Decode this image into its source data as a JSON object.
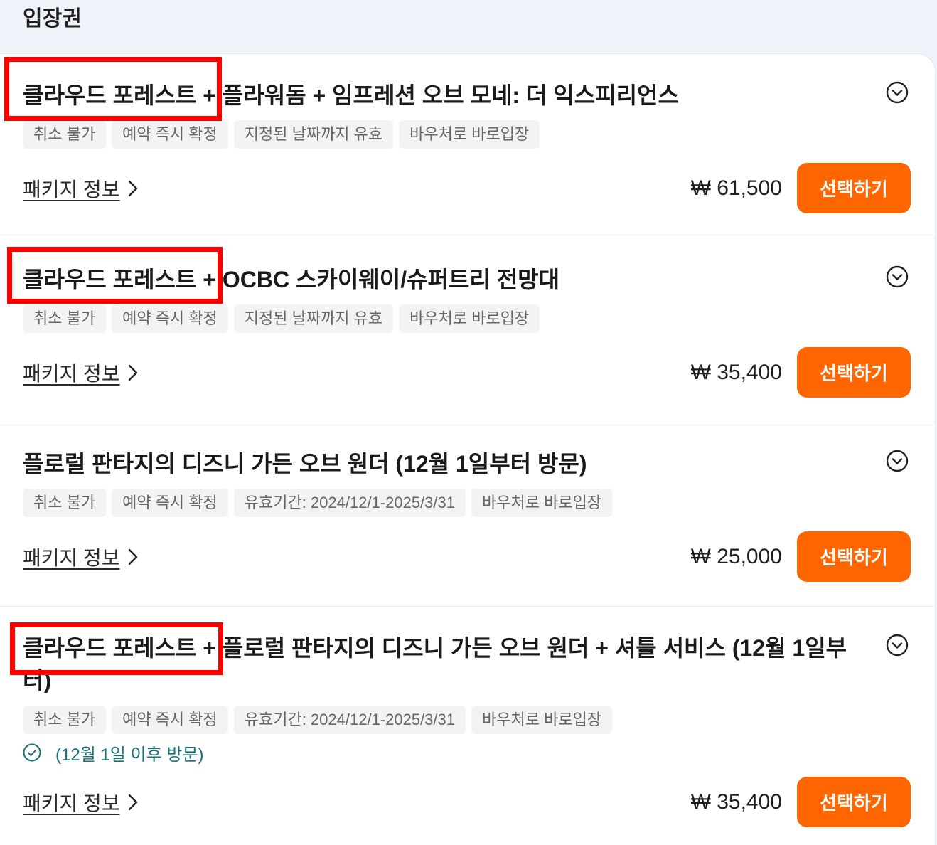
{
  "section": {
    "title": "입장권"
  },
  "packages": [
    {
      "title": "클라우드 포레스트 + 플라워돔 + 임프레션 오브 모네: 더 익스피리언스",
      "tags": [
        "취소 불가",
        "예약 즉시 확정",
        "지정된 날짜까지 유효",
        "바우처로 바로입장"
      ],
      "info_label": "패키지 정보",
      "price": "₩ 61,500",
      "select_label": "선택하기"
    },
    {
      "title": "클라우드 포레스트 + OCBC 스카이웨이/슈퍼트리 전망대",
      "tags": [
        "취소 불가",
        "예약 즉시 확정",
        "지정된 날짜까지 유효",
        "바우처로 바로입장"
      ],
      "info_label": "패키지 정보",
      "price": "₩ 35,400",
      "select_label": "선택하기"
    },
    {
      "title": "플로럴 판타지의 디즈니 가든 오브 원더 (12월 1일부터 방문)",
      "tags": [
        "취소 불가",
        "예약 즉시 확정",
        "유효기간: 2024/12/1-2025/3/31",
        "바우처로 바로입장"
      ],
      "info_label": "패키지 정보",
      "price": "₩ 25,000",
      "select_label": "선택하기"
    },
    {
      "title": "클라우드 포레스트 + 플로럴 판타지의 디즈니 가든 오브 원더 + 셔틀 서비스 (12월 1일부터)",
      "tags": [
        "취소 불가",
        "예약 즉시 확정",
        "유효기간: 2024/12/1-2025/3/31",
        "바우처로 바로입장"
      ],
      "note": "(12월 1일 이후 방문)",
      "info_label": "패키지 정보",
      "price": "₩ 35,400",
      "select_label": "선택하기"
    }
  ],
  "icons": {
    "expand": "chevron-down-circle-icon",
    "info_arrow": "chevron-right-icon",
    "note": "check-circle-icon"
  },
  "colors": {
    "accent": "#ff6600",
    "note": "#17707a",
    "tag_background": "#f2f3f5",
    "annotation": "#ff0000",
    "page_background": "#eef3fa"
  }
}
